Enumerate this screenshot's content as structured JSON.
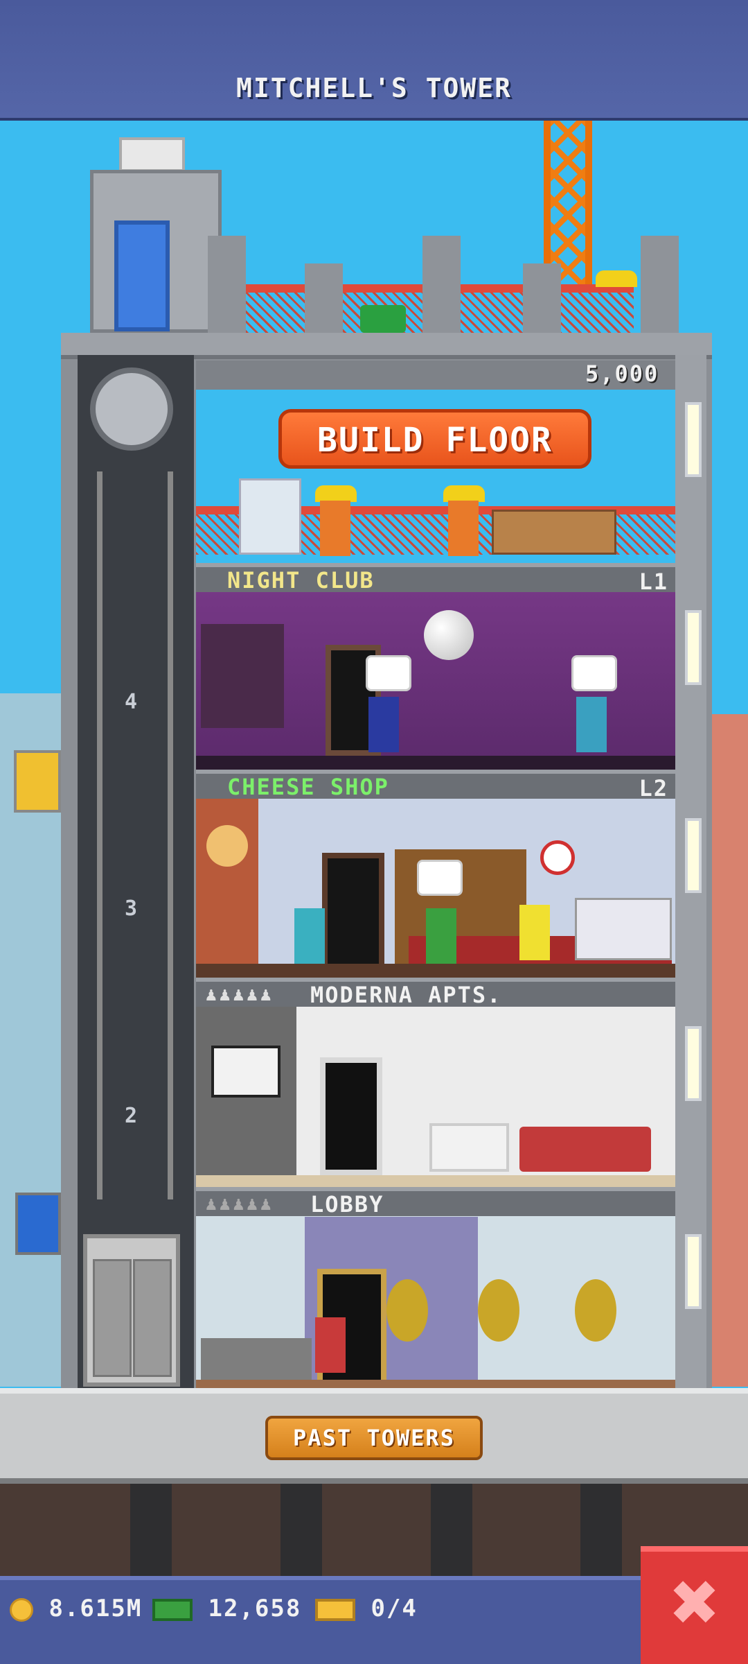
{
  "header": {
    "title": "MITCHELL'S TOWER"
  },
  "build_floor": {
    "cost": "5,000",
    "button_label": "BUILD FLOOR"
  },
  "floors": [
    {
      "name": "NIGHT CLUB",
      "level": "L1",
      "name_color": "#f2e68a"
    },
    {
      "name": "CHEESE SHOP",
      "level": "L2",
      "name_color": "#7cf06a"
    },
    {
      "name": "MODERNA APTS.",
      "level": "",
      "name_color": "#f2f2f2"
    },
    {
      "name": "LOBBY",
      "level": "",
      "name_color": "#f2f2f2"
    }
  ],
  "elevator": {
    "floor_numbers": [
      "4",
      "3",
      "2"
    ]
  },
  "ground": {
    "past_towers_label": "PAST TOWERS"
  },
  "status": {
    "coins": "8.615M",
    "cash": "12,658",
    "tickets": "0/4"
  },
  "close": {
    "icon": "close-icon"
  },
  "colors": {
    "accent_orange": "#e8541c",
    "header_blue": "#4a5a9c",
    "close_red": "#e03a3a"
  }
}
